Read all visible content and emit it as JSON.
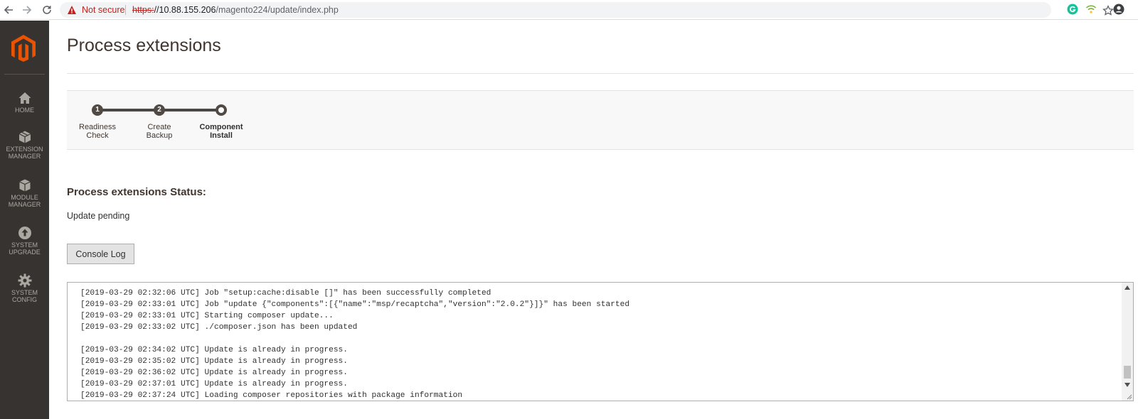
{
  "browser": {
    "security_label": "Not secure",
    "url_scheme": "https:",
    "url_rest_host": "//10.88.155.206",
    "url_path": "/magento224/update/index.php",
    "icons": [
      "back-arrow-icon",
      "forward-arrow-icon",
      "reload-icon",
      "warning-icon",
      "star-icon",
      "grammarly-icon",
      "wifi-extension-icon",
      "account-icon"
    ]
  },
  "sidebar": {
    "logo": "magento-logo",
    "items": [
      {
        "label_line1": "HOME",
        "label_line2": "",
        "icon": "home-icon"
      },
      {
        "label_line1": "EXTENSION",
        "label_line2": "MANAGER",
        "icon": "extension-box-icon"
      },
      {
        "label_line1": "MODULE",
        "label_line2": "MANAGER",
        "icon": "module-box-icon"
      },
      {
        "label_line1": "SYSTEM",
        "label_line2": "UPGRADE",
        "icon": "upgrade-arrow-icon"
      },
      {
        "label_line1": "SYSTEM",
        "label_line2": "CONFIG",
        "icon": "gear-icon"
      }
    ]
  },
  "page": {
    "title": "Process extensions"
  },
  "steps": [
    {
      "number": "1",
      "label": "Readiness\nCheck",
      "state": "done"
    },
    {
      "number": "2",
      "label": "Create\nBackup",
      "state": "done"
    },
    {
      "number": "",
      "label": "Component\nInstall",
      "state": "current"
    }
  ],
  "status": {
    "heading": "Process extensions Status:",
    "text": "Update pending"
  },
  "console": {
    "button_label": "Console Log",
    "lines": [
      "[2019-03-29 02:32:06 UTC] Job \"setup:cache:disable []\" has been successfully completed",
      "[2019-03-29 02:33:01 UTC] Job \"update {\"components\":[{\"name\":\"msp/recaptcha\",\"version\":\"2.0.2\"}]}\" has been started",
      "[2019-03-29 02:33:01 UTC] Starting composer update...",
      "[2019-03-29 02:33:02 UTC] ./composer.json has been updated",
      "",
      "[2019-03-29 02:34:02 UTC] Update is already in progress.",
      "[2019-03-29 02:35:02 UTC] Update is already in progress.",
      "[2019-03-29 02:36:02 UTC] Update is already in progress.",
      "[2019-03-29 02:37:01 UTC] Update is already in progress.",
      "[2019-03-29 02:37:24 UTC] Loading composer repositories with package information"
    ]
  },
  "colors": {
    "sidebar_bg": "#373330",
    "logo_orange": "#eb5202",
    "step_dark": "#514943",
    "danger_red": "#c5221f"
  }
}
